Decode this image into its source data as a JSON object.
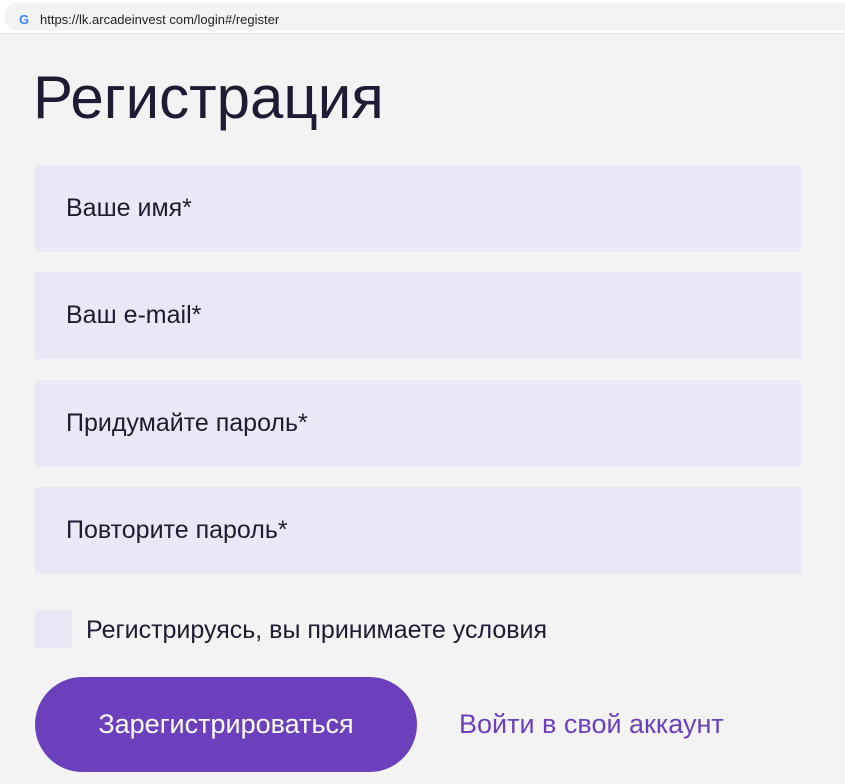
{
  "browser": {
    "url": "https://lk.arcadeinvest com/login#/register",
    "favicon_icon": "google-g-icon",
    "favicon_letter": "G"
  },
  "page": {
    "title": "Регистрация"
  },
  "form": {
    "name_placeholder": "Ваше имя*",
    "email_placeholder": "Ваш e-mail*",
    "password_placeholder": "Придумайте пароль*",
    "repeat_password_placeholder": "Повторите пароль*",
    "terms_label": "Регистрируясь, вы принимаете условия",
    "terms_checked": false,
    "submit_label": "Зарегистрироваться",
    "login_link_label": "Войти в свой аккаунт"
  },
  "colors": {
    "accent": "#6c3fbd",
    "field_background": "#ece7f4",
    "text": "#201a33",
    "page_background": "#f3f3f4"
  }
}
